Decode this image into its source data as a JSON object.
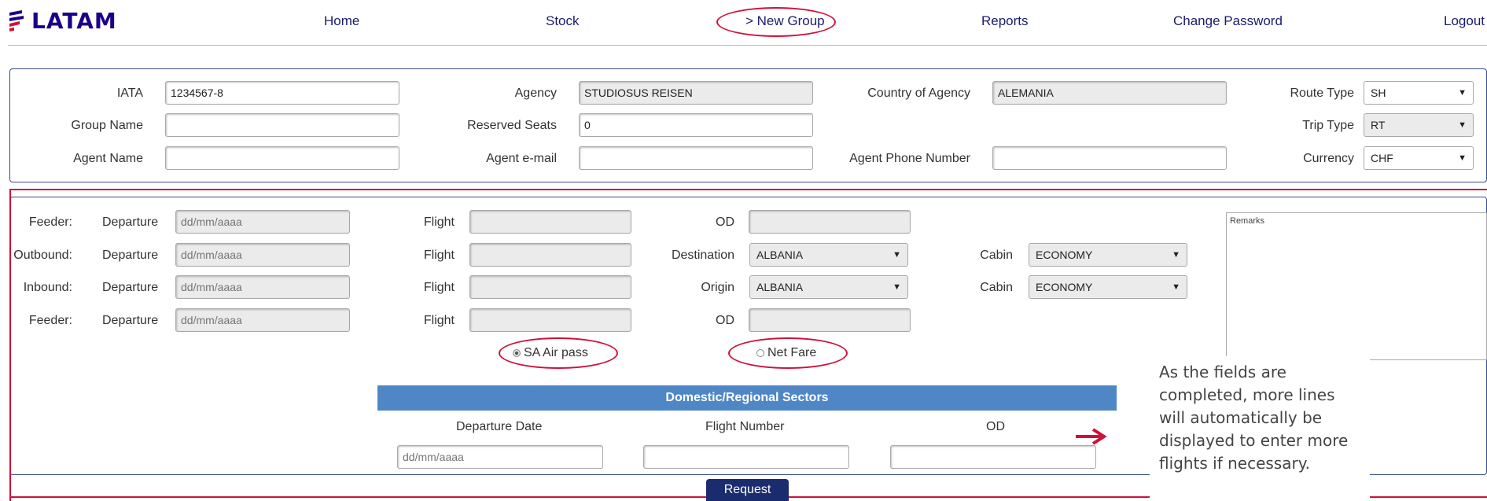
{
  "header": {
    "logo_text": "LATAM",
    "nav": [
      {
        "label": "Home"
      },
      {
        "label": "Stock"
      },
      {
        "label": "> New Group"
      },
      {
        "label": "Reports"
      },
      {
        "label": "Change Password"
      },
      {
        "label": "Logout"
      }
    ]
  },
  "agency_form": {
    "iata_label": "IATA",
    "iata_value": "1234567-8",
    "agency_label": "Agency",
    "agency_value": "STUDIOSUS REISEN",
    "country_label": "Country of Agency",
    "country_value": "ALEMANIA",
    "route_type_label": "Route Type",
    "route_type_value": "SH",
    "group_name_label": "Group Name",
    "group_name_value": "",
    "reserved_seats_label": "Reserved Seats",
    "reserved_seats_value": "0",
    "trip_type_label": "Trip Type",
    "trip_type_value": "RT",
    "agent_name_label": "Agent Name",
    "agent_name_value": "",
    "agent_email_label": "Agent e-mail",
    "agent_email_value": "",
    "agent_phone_label": "Agent Phone Number",
    "agent_phone_value": "",
    "currency_label": "Currency",
    "currency_value": "CHF"
  },
  "flights": {
    "rows": [
      {
        "type": "Feeder:",
        "departure_label": "Departure",
        "date_placeholder": "dd/mm/aaaa",
        "flight_label": "Flight",
        "third_label": "OD"
      },
      {
        "type": "Outbound:",
        "departure_label": "Departure",
        "date_placeholder": "dd/mm/aaaa",
        "flight_label": "Flight",
        "third_label": "Destination",
        "third_value": "ALBANIA",
        "cabin_label": "Cabin",
        "cabin_value": "ECONOMY"
      },
      {
        "type": "Inbound:",
        "departure_label": "Departure",
        "date_placeholder": "dd/mm/aaaa",
        "flight_label": "Flight",
        "third_label": "Origin",
        "third_value": "ALBANIA",
        "cabin_label": "Cabin",
        "cabin_value": "ECONOMY"
      },
      {
        "type": "Feeder:",
        "departure_label": "Departure",
        "date_placeholder": "dd/mm/aaaa",
        "flight_label": "Flight",
        "third_label": "OD"
      }
    ],
    "remarks_placeholder": "Remarks",
    "radio_sa_air_pass": "SA Air pass",
    "radio_net_fare": "Net Fare"
  },
  "domestic": {
    "title": "Domestic/Regional Sectors",
    "col_departure_date": "Departure Date",
    "col_flight_number": "Flight Number",
    "col_od": "OD",
    "date_placeholder": "dd/mm/aaaa"
  },
  "request_label": "Request",
  "tooltip": "As the fields are completed, more lines will automatically be displayed to enter more flights if necessary.",
  "colors": {
    "brand": "#1b0088",
    "highlight": "#d0103a",
    "panel_border": "#3a4e8c",
    "bar": "#4f86c6",
    "button": "#1b2c6e"
  }
}
